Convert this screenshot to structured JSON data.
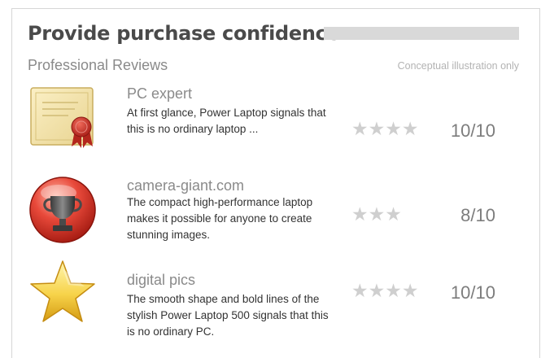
{
  "header": {
    "title": "Provide purchase confidence",
    "section_label": "Professional Reviews",
    "note": "Conceptual illustration only"
  },
  "reviews": [
    {
      "source": "PC expert",
      "text": "At first glance, Power Laptop signals that this is no ordinary laptop ...",
      "stars": "★★★★",
      "rating_stars": 4,
      "score": "10/10",
      "icon": "certificate-icon"
    },
    {
      "source": "camera-giant.com",
      "text": "The compact high-performance laptop makes it possible for anyone to  create stunning images.",
      "stars": "★★★",
      "rating_stars": 3,
      "score": "8/10",
      "icon": "trophy-icon"
    },
    {
      "source": "digital pics",
      "text": "The smooth shape and bold lines of the stylish Power Laptop 500 signals that this is no ordinary PC.",
      "stars": "★★★★",
      "rating_stars": 4,
      "score": "10/10",
      "icon": "star-icon"
    }
  ]
}
